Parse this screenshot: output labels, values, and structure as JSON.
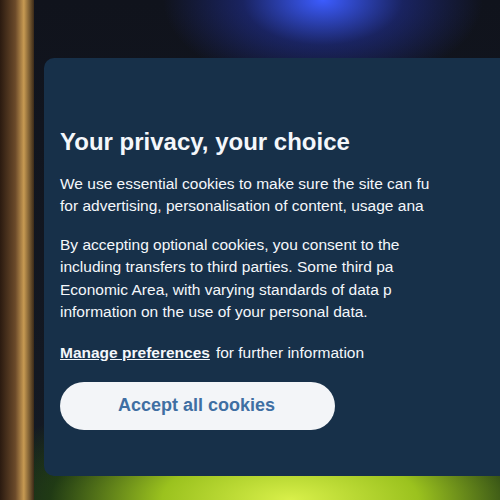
{
  "banner": {
    "title": "Your privacy, your choice",
    "paragraphs": [
      [
        "We use essential cookies to make sure the site can fu",
        "for advertising, personalisation of content, usage ana"
      ],
      [
        "By accepting optional cookies, you consent to the",
        "including transfers to third parties. Some third pa",
        "Economic Area, with varying standards of data p",
        "information on the use of your personal data."
      ]
    ],
    "link": "Manage preferences",
    "link_suffix": "for further information",
    "button": "Accept all cookies"
  }
}
